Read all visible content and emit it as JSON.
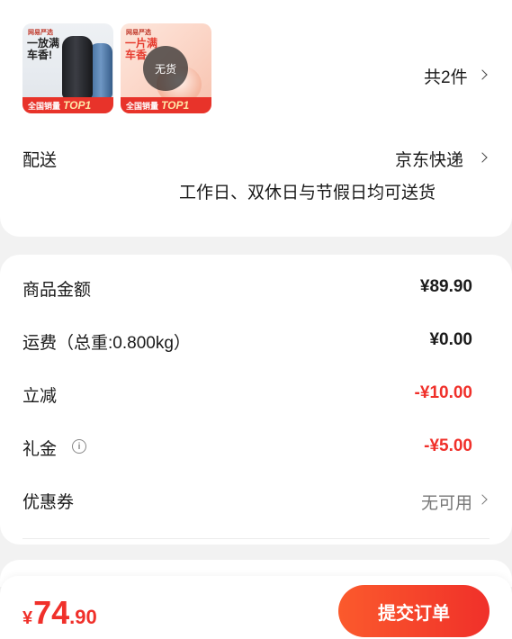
{
  "products": {
    "items": [
      {
        "brand": "网易严选",
        "slogan": "一放满车香!",
        "badge_prefix": "全国销量",
        "badge_top": "TOP1"
      },
      {
        "brand": "网易严选",
        "slogan": "一片满车香",
        "badge_prefix": "全国销量",
        "badge_top": "TOP1",
        "overlay": "无货"
      }
    ],
    "count_label": "共2件"
  },
  "delivery": {
    "label": "配送",
    "carrier": "京东快递",
    "note": "工作日、双休日与节假日均可送货"
  },
  "summary": {
    "goods_label": "商品金额",
    "goods_value": "¥89.90",
    "shipping_label": "运费（总重:0.800kg）",
    "shipping_value": "¥0.00",
    "discount_label": "立减",
    "discount_value": "-¥10.00",
    "gift_label": "礼金",
    "gift_value": "-¥5.00",
    "coupon_label": "优惠券",
    "coupon_value": "无可用"
  },
  "footer": {
    "currency": "¥",
    "price_int": "74",
    "price_dec": ".90",
    "submit_label": "提交订单"
  },
  "colors": {
    "accent": "#f0302a",
    "accent_start": "#fb5a2c",
    "background": "#f2f2f2"
  }
}
